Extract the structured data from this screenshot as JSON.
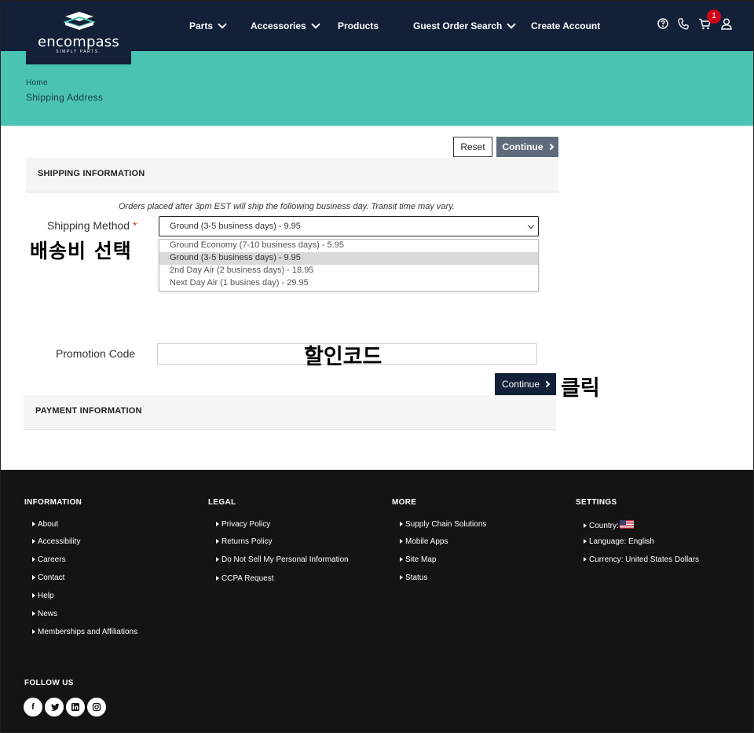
{
  "brand": {
    "name": "encompass",
    "tagline": "SIMPLY PARTS."
  },
  "nav": [
    {
      "label": "Parts",
      "has_dropdown": true
    },
    {
      "label": "Accessories",
      "has_dropdown": true
    },
    {
      "label": "Products",
      "has_dropdown": false
    },
    {
      "label": "Guest Order Search",
      "has_dropdown": true
    },
    {
      "label": "Create Account",
      "has_dropdown": false
    }
  ],
  "header_icons": [
    "help-icon",
    "phone-icon",
    "cart-icon",
    "user-icon"
  ],
  "cart_count": "1",
  "breadcrumb": {
    "home": "Home",
    "current": "Shipping Address"
  },
  "actions": {
    "reset": "Reset",
    "continue": "Continue"
  },
  "shipping": {
    "title": "SHIPPING INFORMATION",
    "notice": "Orders placed after 3pm EST will ship the following business day. Transit time may vary.",
    "method_label": "Shipping Method",
    "required_mark": "*",
    "selected": "Ground (3-5 business days) - 9.95",
    "options": [
      "Ground Economy (7-10 business days) - 5.95",
      "Ground (3-5 business days) - 9.95",
      "2nd Day Air (2 business days) - 18.95",
      "Next Day Air (1 busines day) - 29.95"
    ],
    "promo_label": "Promotion Code",
    "promo_value": "",
    "continue": "Continue"
  },
  "payment": {
    "title": "PAYMENT INFORMATION"
  },
  "annotations": {
    "shipping_select": "배송비 선택",
    "promo": "할인코드",
    "click": "클릭"
  },
  "footer": {
    "information": {
      "title": "INFORMATION",
      "links": [
        "About",
        "Accessibility",
        "Careers",
        "Contact",
        "Help",
        "News",
        "Memberships and Affiliations"
      ]
    },
    "legal": {
      "title": "LEGAL",
      "links": [
        "Privacy Policy",
        "Returns Policy",
        "Do Not Sell My Personal Information",
        "CCPA Request"
      ]
    },
    "more": {
      "title": "MORE",
      "links": [
        "Supply Chain Solutions",
        "Mobile Apps",
        "Site Map",
        "Status"
      ]
    },
    "settings": {
      "title": "SETTINGS",
      "country": "Country:",
      "language": "Language: English",
      "currency": "Currency: United States Dollars"
    },
    "follow": {
      "title": "FOLLOW US",
      "networks": [
        "facebook-icon",
        "twitter-icon",
        "linkedin-icon",
        "instagram-icon"
      ]
    }
  },
  "colors": {
    "navy": "#122038",
    "teal": "#4ac3b3",
    "badge": "#d0021b",
    "footer": "#141414"
  }
}
